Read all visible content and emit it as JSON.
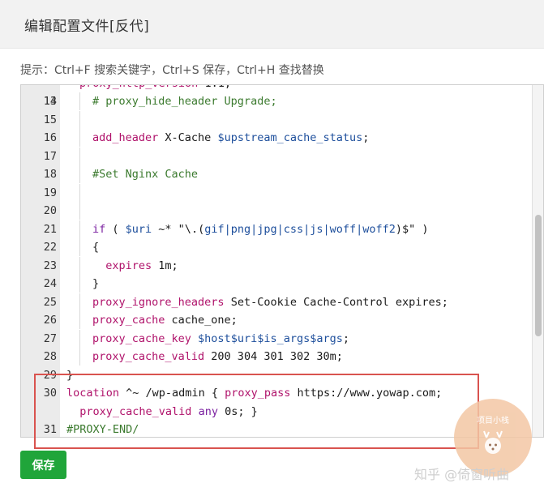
{
  "window": {
    "title": "编辑配置文件[反代]"
  },
  "hint": "提示：Ctrl+F 搜索关键字，Ctrl+S 保存，Ctrl+H 查找替换",
  "editor": {
    "lines": [
      {
        "no": "14",
        "tokens": [
          {
            "t": "# proxy_hide_header Upgrade;",
            "c": "com"
          }
        ]
      },
      {
        "no": "15",
        "tokens": []
      },
      {
        "no": "16",
        "tokens": [
          {
            "t": "add_header",
            "c": "fn"
          },
          {
            "t": " X-Cache ",
            "c": "str"
          },
          {
            "t": "$upstream_cache_status",
            "c": "var"
          },
          {
            "t": ";",
            "c": "str"
          }
        ]
      },
      {
        "no": "17",
        "tokens": []
      },
      {
        "no": "18",
        "tokens": [
          {
            "t": "#Set Nginx Cache",
            "c": "com"
          }
        ]
      },
      {
        "no": "19",
        "tokens": []
      },
      {
        "no": "20",
        "tokens": []
      },
      {
        "no": "21",
        "tokens": [
          {
            "t": "if",
            "c": "kw"
          },
          {
            "t": " ( ",
            "c": "str"
          },
          {
            "t": "$uri",
            "c": "var"
          },
          {
            "t": " ~* \"\\.(",
            "c": "str"
          },
          {
            "t": "gif|png|jpg|css|js|woff|woff2",
            "c": "var"
          },
          {
            "t": ")$\" )",
            "c": "str"
          }
        ]
      },
      {
        "no": "22",
        "tokens": [
          {
            "t": "{",
            "c": "str"
          }
        ]
      },
      {
        "no": "23",
        "tokens": [
          {
            "t": "  expires",
            "c": "fn"
          },
          {
            "t": " 1m;",
            "c": "str"
          }
        ]
      },
      {
        "no": "24",
        "tokens": [
          {
            "t": "}",
            "c": "str"
          }
        ]
      },
      {
        "no": "25",
        "tokens": [
          {
            "t": "proxy_ignore_headers",
            "c": "fn"
          },
          {
            "t": " Set-Cookie Cache-Control expires;",
            "c": "str"
          }
        ]
      },
      {
        "no": "26",
        "tokens": [
          {
            "t": "proxy_cache",
            "c": "fn"
          },
          {
            "t": " cache_one;",
            "c": "str"
          }
        ]
      },
      {
        "no": "27",
        "tokens": [
          {
            "t": "proxy_cache_key",
            "c": "fn"
          },
          {
            "t": " $host$uri$is_args$args",
            "c": "var"
          },
          {
            "t": ";",
            "c": "str"
          }
        ]
      },
      {
        "no": "28",
        "tokens": [
          {
            "t": "proxy_cache_valid",
            "c": "fn"
          },
          {
            "t": " 200 304 301 302 30m;",
            "c": "str"
          }
        ]
      },
      {
        "no": "29",
        "tokens": [
          {
            "t": "}",
            "c": "str"
          }
        ]
      },
      {
        "no": "30",
        "tokens": [
          {
            "t": "location",
            "c": "fn"
          },
          {
            "t": " ^~ /wp-admin { ",
            "c": "str"
          },
          {
            "t": "proxy_pass",
            "c": "fn"
          },
          {
            "t": " https://www.yowap.com;",
            "c": "str"
          }
        ]
      },
      {
        "no": "",
        "tokens": [
          {
            "t": "  proxy_cache_valid",
            "c": "fn"
          },
          {
            "t": " any",
            "c": "kw"
          },
          {
            "t": " 0s; }",
            "c": "str"
          }
        ]
      },
      {
        "no": "31",
        "tokens": [
          {
            "t": "#PROXY-END/",
            "c": "com"
          }
        ]
      }
    ]
  },
  "buttons": {
    "save": "保存"
  },
  "watermark": "知乎 @倚窗听曲",
  "badge": "项目小栈",
  "colors": {
    "save_button": "#20a53a",
    "highlight_border": "#d9534f",
    "comment": "#3b7a2e",
    "function": "#b0136b",
    "variable": "#1e4f9c",
    "keyword": "#7a1fa0"
  }
}
